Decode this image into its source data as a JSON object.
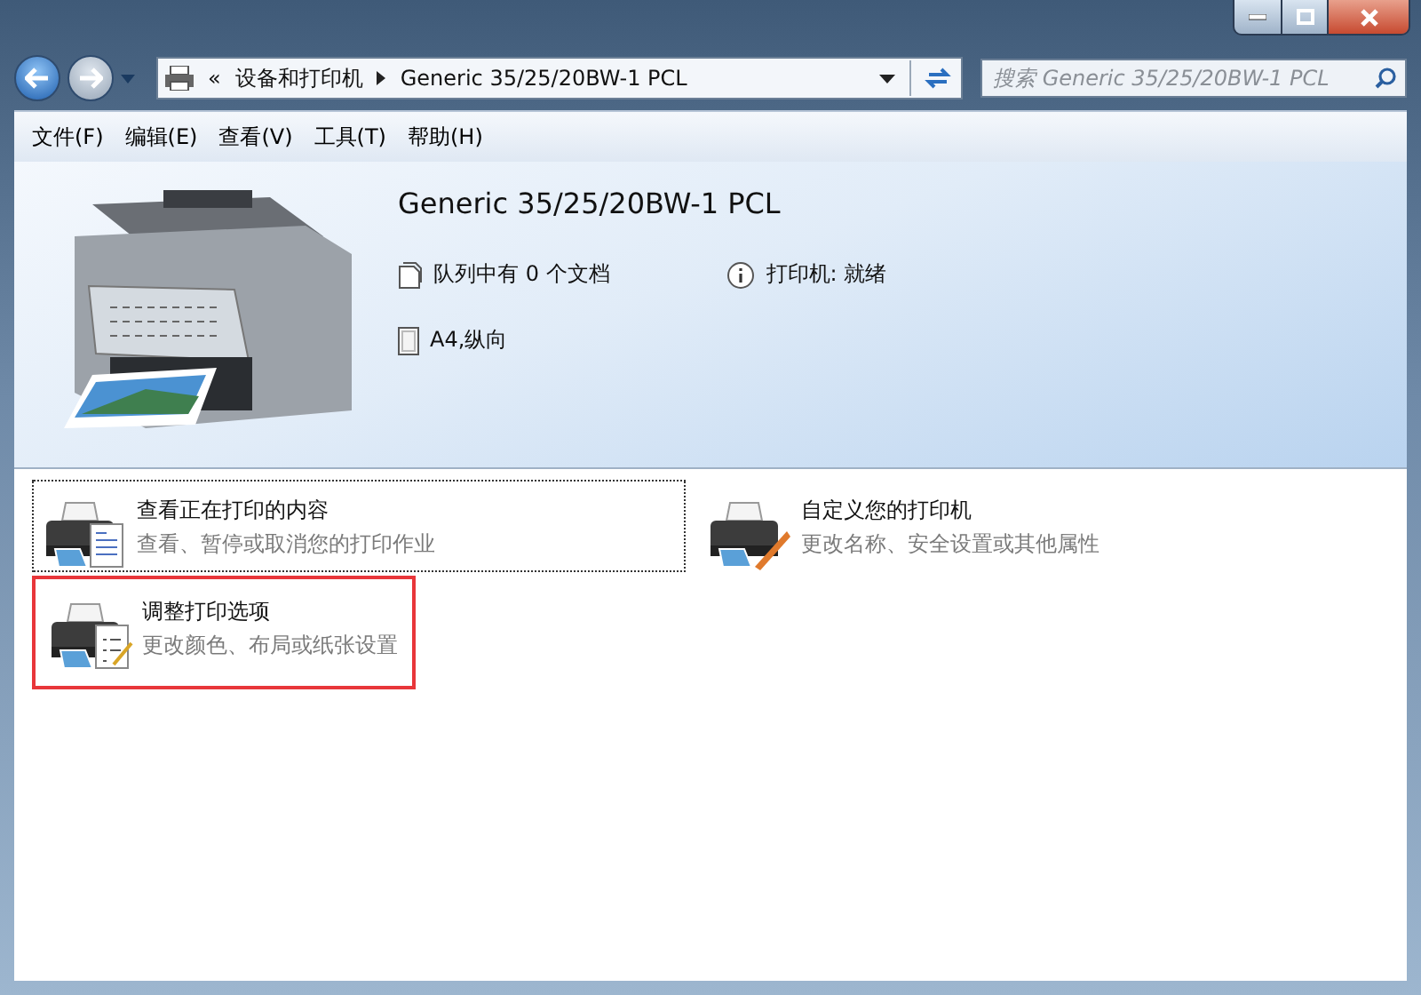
{
  "address_bar": {
    "separator": "«",
    "crumbs": [
      "设备和打印机",
      "Generic 35/25/20BW-1 PCL"
    ],
    "search_placeholder": "搜索 Generic 35/25/20BW-1 PCL"
  },
  "menu": [
    "文件(F)",
    "编辑(E)",
    "查看(V)",
    "工具(T)",
    "帮助(H)"
  ],
  "printer": {
    "name": "Generic 35/25/20BW-1 PCL",
    "queue": "队列中有 0 个文档",
    "status": "打印机: 就绪",
    "paper": "A4,纵向"
  },
  "tasks": [
    {
      "kind": "queue",
      "title": "查看正在打印的内容",
      "subtitle": "查看、暂停或取消您的打印作业",
      "focused": true,
      "highlighted": false
    },
    {
      "kind": "customize",
      "title": "自定义您的打印机",
      "subtitle": "更改名称、安全设置或其他属性",
      "focused": false,
      "highlighted": false
    },
    {
      "kind": "options",
      "title": "调整打印选项",
      "subtitle": "更改颜色、布局或纸张设置",
      "focused": false,
      "highlighted": true
    }
  ]
}
